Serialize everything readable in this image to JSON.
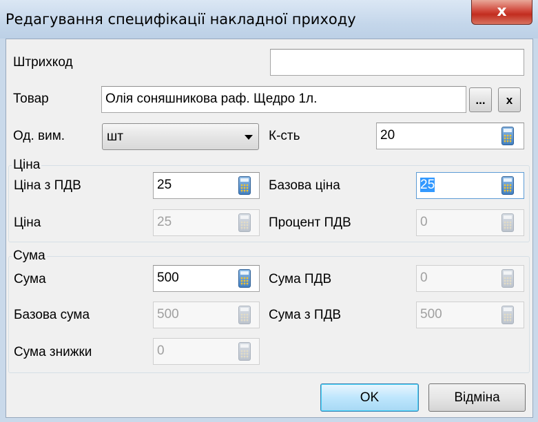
{
  "window": {
    "title": "Редагування специфікації накладної приходу",
    "close_glyph": "x"
  },
  "fields": {
    "barcode": {
      "label": "Штрихкод",
      "value": ""
    },
    "product": {
      "label": "Товар",
      "value": "Олія соняшникова раф.  Щедро 1л.",
      "browse_label": "...",
      "clear_label": "x"
    },
    "unit": {
      "label": "Од. вим.",
      "value": "шт"
    },
    "quantity": {
      "label": "К-сть",
      "value": "20"
    }
  },
  "price_group": {
    "title": "Ціна",
    "price_with_vat": {
      "label": "Ціна з ПДВ",
      "value": "25"
    },
    "base_price": {
      "label": "Базова ціна",
      "value": "25"
    },
    "price": {
      "label": "Ціна",
      "value": "25"
    },
    "vat_percent": {
      "label": "Процент ПДВ",
      "value": "0"
    }
  },
  "sum_group": {
    "title": "Сума",
    "sum": {
      "label": "Сума",
      "value": "500"
    },
    "vat_sum": {
      "label": "Сума ПДВ",
      "value": "0"
    },
    "base_sum": {
      "label": "Базова сума",
      "value": "500"
    },
    "sum_with_vat": {
      "label": "Сума з ПДВ",
      "value": "500"
    },
    "discount_sum": {
      "label": "Сума знижки",
      "value": "0"
    }
  },
  "buttons": {
    "ok_label": "OK",
    "cancel_label": "Відміна"
  },
  "icons": {
    "calculator": "calculator-icon",
    "dropdown": "chevron-down-icon"
  }
}
